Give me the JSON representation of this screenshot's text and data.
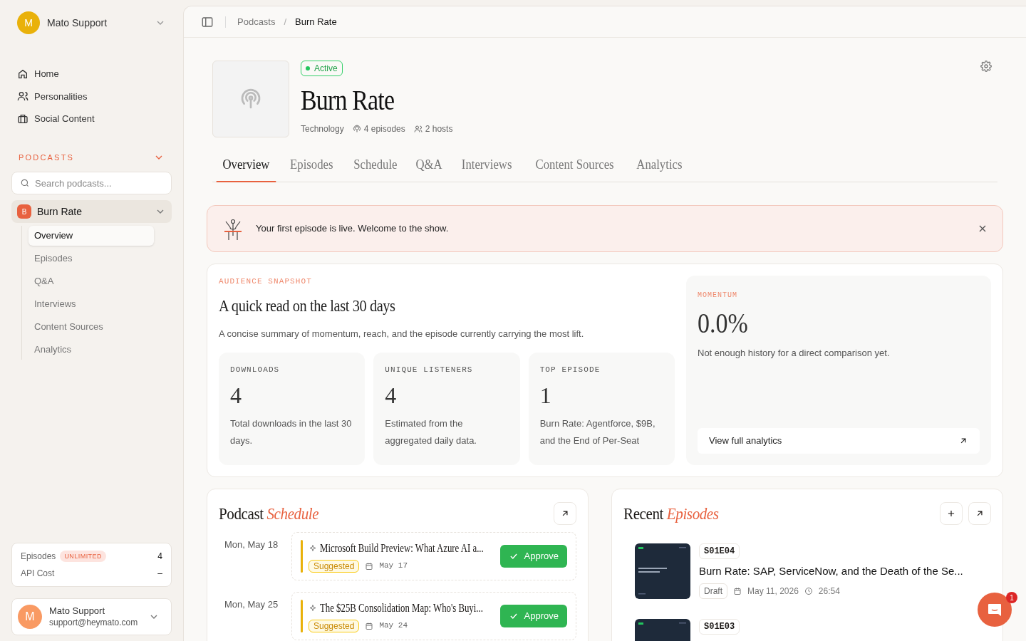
{
  "workspace": {
    "avatar": "M",
    "name": "Mato Support"
  },
  "nav": [
    {
      "kind": "home",
      "label": "Home"
    },
    {
      "kind": "people",
      "label": "Personalities"
    },
    {
      "kind": "briefcase",
      "label": "Social Content"
    }
  ],
  "podcasts_section": {
    "title": "PODCASTS",
    "expanded": true
  },
  "search": {
    "placeholder": "Search podcasts..."
  },
  "podcast_tree": [
    {
      "badge": "B",
      "label": "Burn Rate",
      "expanded": true,
      "children": [
        {
          "label": "Overview",
          "selected": true
        },
        {
          "label": "Episodes",
          "selected": false
        },
        {
          "label": "Q&A",
          "selected": false
        },
        {
          "label": "Interviews",
          "selected": false
        },
        {
          "label": "Content Sources",
          "selected": false
        },
        {
          "label": "Analytics",
          "selected": false
        }
      ]
    }
  ],
  "usage": [
    {
      "label": "Episodes",
      "badge": "UNLIMITED",
      "value": "4"
    },
    {
      "label": "API Cost",
      "value": "–"
    }
  ],
  "account": {
    "avatar": "M",
    "name": "Mato Support",
    "email": "support@heymato.com"
  },
  "breadcrumb": {
    "items": [
      "Podcasts",
      "Burn Rate"
    ],
    "separator": "/"
  },
  "podcast": {
    "status": "Active",
    "title": "Burn Rate",
    "category": "Technology",
    "episodes": "4 episodes",
    "hosts": "2 hosts"
  },
  "tabs": [
    {
      "label": "Overview",
      "selected": true
    },
    {
      "label": "Episodes",
      "selected": false
    },
    {
      "label": "Schedule",
      "selected": false
    },
    {
      "label": "Q&A",
      "selected": false
    },
    {
      "label": "Interviews",
      "selected": false
    },
    {
      "label": "Content Sources",
      "selected": false
    },
    {
      "label": "Analytics",
      "selected": false
    }
  ],
  "banner": {
    "message": "Your first episode is live. Welcome to the show."
  },
  "snapshot": {
    "eyebrow": "AUDIENCE SNAPSHOT",
    "title": "A quick read on the last 30 days",
    "description": "A concise summary of momentum, reach, and the episode currently carrying the most lift.",
    "stats": [
      {
        "label": "DOWNLOADS",
        "value": "4",
        "note": "Total downloads in the last 30 days."
      },
      {
        "label": "UNIQUE LISTENERS",
        "value": "4",
        "note": "Estimated from the aggregated daily data."
      },
      {
        "label": "TOP EPISODE",
        "value": "1",
        "note": "Burn Rate: Agentforce, $9B, and the End of Per-Seat"
      }
    ]
  },
  "momentum": {
    "eyebrow": "MOMENTUM",
    "value": "0.0%",
    "note": "Not enough history for a direct comparison yet.",
    "link": "View full analytics"
  },
  "schedule": {
    "title": "Podcast",
    "title_accent": "Schedule",
    "items": [
      {
        "date": "Mon, May 18",
        "title": "Microsoft Build Preview: What Azure AI a...",
        "status": "Suggested",
        "due": "May 17",
        "action": "Approve"
      },
      {
        "date": "Mon, May 25",
        "title": "The $25B Consolidation Map: Who's Buyi...",
        "status": "Suggested",
        "due": "May 24",
        "action": "Approve"
      }
    ]
  },
  "recent": {
    "title": "Recent",
    "title_accent": "Episodes",
    "episodes": [
      {
        "code": "S01E04",
        "title": "Burn Rate: SAP, ServiceNow, and the Death of the Se...",
        "status": "Draft",
        "date": "May 11, 2026",
        "duration": "26:54"
      },
      {
        "code": "S01E03"
      }
    ]
  },
  "chat": {
    "count": "1"
  }
}
